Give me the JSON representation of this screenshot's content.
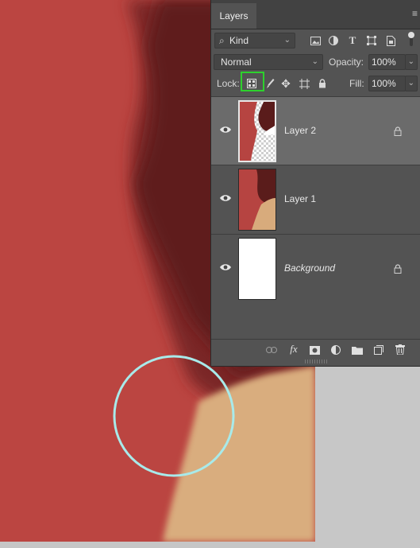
{
  "panel": {
    "tab_title": "Layers",
    "menu_glyph": "≡",
    "filter": {
      "value": "Kind",
      "search_glyph": "⌕"
    },
    "blend_mode": {
      "value": "Normal"
    },
    "opacity": {
      "label": "Opacity:",
      "value": "100%"
    },
    "lock": {
      "label": "Lock:"
    },
    "fill": {
      "label": "Fill:",
      "value": "100%"
    },
    "layers": [
      {
        "name": "Layer 2",
        "selected": true,
        "locked": true,
        "visible": true
      },
      {
        "name": "Layer 1",
        "selected": false,
        "locked": false,
        "visible": true
      },
      {
        "name": "Background",
        "selected": false,
        "locked": true,
        "visible": true
      }
    ],
    "footer_icons": [
      "link-icon",
      "fx-icon",
      "add-mask-icon",
      "adjustment-icon",
      "group-folder-icon",
      "new-layer-icon",
      "trash-icon"
    ],
    "fx_label": "fx"
  },
  "highlight_colors": {
    "lock_box": "#2dd12d",
    "brush_circle": "#a8eaea"
  }
}
